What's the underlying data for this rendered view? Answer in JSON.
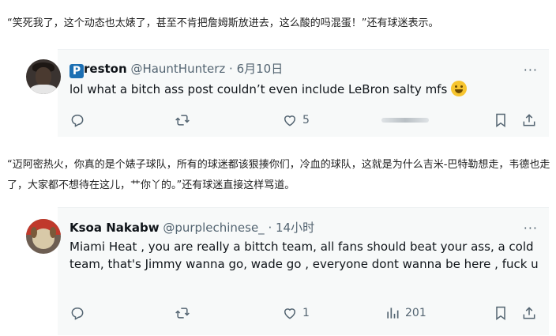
{
  "article": {
    "para1": "“笑死我了，这个动态也太婊了，甚至不肯把詹姆斯放进去，这么酸的吗混蛋！”还有球迷表示。",
    "para2": "“迈阿密热火，你真的是个婊子球队，所有的球迷都该狠揍你们，冷血的球队，这就是为什么吉米-巴特勒想走，韦德也走了，大家都不想待在这儿，艹你丫的。”还有球迷直接这样骂道。"
  },
  "tweets": [
    {
      "badge": "P",
      "name": "reston",
      "handle": "@HauntHunterz",
      "sep": " · ",
      "time": "6月10日",
      "text": "lol what a bitch ass post couldn’t even include LeBron salty mfs",
      "emoji": "grinning-squinting-face",
      "more": "···",
      "likes": "5",
      "views": ""
    },
    {
      "name": "Ksoa Nakabw",
      "handle": "@purplechinese_",
      "sep": " · ",
      "time": "14小时",
      "text": "Miami Heat ,  you are really a bittch team, all fans  should beat your ass, a cold team, that's Jimmy wanna go, wade go , everyone dont wanna be here , fuck u",
      "more": "···",
      "likes": "1",
      "views": "201"
    }
  ],
  "colors": {
    "card_bg": "#f7f9f9",
    "muted": "#536471",
    "badge": "#1b6fb3"
  }
}
